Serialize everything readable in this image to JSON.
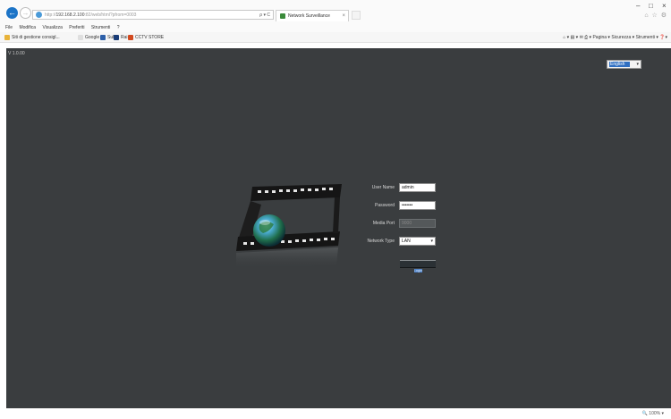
{
  "browser": {
    "address": "http://192.168.2.100:82/web/html?pfrom=0003",
    "address_prefix": "http://",
    "address_host": "192.168.2.100",
    "address_rest": ":82/web/html?pfrom=0003",
    "address_tools": "ρ ▾ C",
    "tab_title": "Network Surveillance",
    "tab_close": "×",
    "minimize": "–",
    "maximize": "□",
    "close": "×",
    "right_icons": "⌂ ☆ ⚙"
  },
  "menubar": [
    "File",
    "Modifica",
    "Visualizza",
    "Preferiti",
    "Strumenti",
    "?"
  ],
  "favorites": [
    {
      "label": "Siti di gestione consigl..."
    },
    {
      "label": "Google"
    },
    {
      "label": "SuP"
    },
    {
      "label": "Rai"
    },
    {
      "label": "CCTV STORE"
    }
  ],
  "favtools": {
    "home": "⌂ ▾",
    "feeds": "▤ ▾",
    "mail": "✉",
    "print": "⎙ ▾",
    "page": "Pagina ▾",
    "safety": "Sicurezza ▾",
    "tools": "Strumenti ▾",
    "help": "❓▾"
  },
  "page": {
    "version": "V 1.0.00",
    "language": "English",
    "language_arrow": "▾",
    "login": {
      "username_label": "User Name",
      "username_value": "admin",
      "password_label": "Password",
      "password_value": "•••••••",
      "mediaport_label": "Media Port",
      "mediaport_value": "9000",
      "networktype_label": "Network Type",
      "networktype_value": "LAN",
      "networktype_arrow": "▾",
      "login_button": "Login"
    }
  },
  "status": {
    "zoom": "🔍 100% ▾"
  },
  "colors": {
    "page_bg": "#3a3d3f",
    "accent": "#2f6fc2"
  }
}
